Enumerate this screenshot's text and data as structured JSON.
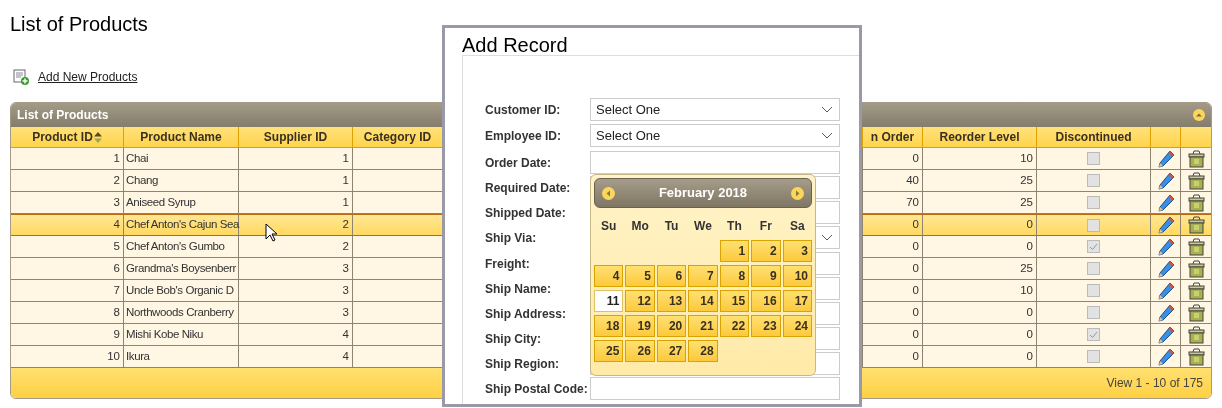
{
  "page_title": "List of Products",
  "add_link": "Add New Products",
  "grid": {
    "title": "List of Products",
    "columns": [
      {
        "label": "Product ID",
        "sorted": true
      },
      {
        "label": "Product Name",
        "sorted": false
      },
      {
        "label": "Supplier ID",
        "sorted": false
      },
      {
        "label": "Category ID",
        "sorted": false
      },
      {
        "label": "n Order",
        "sorted": false
      },
      {
        "label": "Reorder Level",
        "sorted": false
      },
      {
        "label": "Discontinued",
        "sorted": false
      }
    ],
    "rows": [
      {
        "product_id": "1",
        "product_name": "Chai",
        "supplier_id": "1",
        "on_order": "0",
        "reorder_level": "10",
        "discontinued": false,
        "selected": false
      },
      {
        "product_id": "2",
        "product_name": "Chang",
        "supplier_id": "1",
        "on_order": "40",
        "reorder_level": "25",
        "discontinued": false,
        "selected": false
      },
      {
        "product_id": "3",
        "product_name": "Aniseed Syrup",
        "supplier_id": "1",
        "on_order": "70",
        "reorder_level": "25",
        "discontinued": false,
        "selected": false
      },
      {
        "product_id": "4",
        "product_name": "Chef Anton's Cajun Sea",
        "supplier_id": "2",
        "on_order": "0",
        "reorder_level": "0",
        "discontinued": false,
        "selected": true
      },
      {
        "product_id": "5",
        "product_name": "Chef Anton's Gumbo",
        "supplier_id": "2",
        "on_order": "0",
        "reorder_level": "0",
        "discontinued": true,
        "selected": false
      },
      {
        "product_id": "6",
        "product_name": "Grandma's Boysenberr",
        "supplier_id": "3",
        "on_order": "0",
        "reorder_level": "25",
        "discontinued": false,
        "selected": false
      },
      {
        "product_id": "7",
        "product_name": "Uncle Bob's Organic D",
        "supplier_id": "3",
        "on_order": "0",
        "reorder_level": "10",
        "discontinued": false,
        "selected": false
      },
      {
        "product_id": "8",
        "product_name": "Northwoods Cranberry",
        "supplier_id": "3",
        "on_order": "0",
        "reorder_level": "0",
        "discontinued": false,
        "selected": false
      },
      {
        "product_id": "9",
        "product_name": "Mishi Kobe Niku",
        "supplier_id": "4",
        "on_order": "0",
        "reorder_level": "0",
        "discontinued": true,
        "selected": false
      },
      {
        "product_id": "10",
        "product_name": "Ikura",
        "supplier_id": "4",
        "on_order": "0",
        "reorder_level": "0",
        "discontinued": false,
        "selected": false
      }
    ],
    "footer": "View 1 - 10 of 175"
  },
  "dialog": {
    "title": "Add Record",
    "fields": [
      {
        "label": "Customer ID:",
        "kind": "select",
        "value": "Select One"
      },
      {
        "label": "Employee ID:",
        "kind": "select",
        "value": "Select One"
      },
      {
        "label": "Order Date:",
        "kind": "text"
      },
      {
        "label": "Required Date:",
        "kind": "text"
      },
      {
        "label": "Shipped Date:",
        "kind": "text"
      },
      {
        "label": "Ship Via:",
        "kind": "select"
      },
      {
        "label": "Freight:",
        "kind": "text"
      },
      {
        "label": "Ship Name:",
        "kind": "text"
      },
      {
        "label": "Ship Address:",
        "kind": "text"
      },
      {
        "label": "Ship City:",
        "kind": "text"
      },
      {
        "label": "Ship Region:",
        "kind": "text"
      },
      {
        "label": "Ship Postal Code:",
        "kind": "text"
      }
    ],
    "calendar": {
      "month": "February 2018",
      "weekdays": [
        "Su",
        "Mo",
        "Tu",
        "We",
        "Th",
        "Fr",
        "Sa"
      ],
      "weeks": [
        [
          {
            "kind": "blank"
          },
          {
            "kind": "blank"
          },
          {
            "kind": "blank"
          },
          {
            "kind": "blank"
          },
          {
            "day": "1",
            "today": false
          },
          {
            "day": "2",
            "today": false
          },
          {
            "day": "3",
            "today": false
          }
        ],
        [
          {
            "day": "4",
            "today": false
          },
          {
            "day": "5",
            "today": false
          },
          {
            "day": "6",
            "today": false
          },
          {
            "day": "7",
            "today": false
          },
          {
            "day": "8",
            "today": false
          },
          {
            "day": "9",
            "today": false
          },
          {
            "day": "10",
            "today": false
          }
        ],
        [
          {
            "day": "11",
            "today": true
          },
          {
            "day": "12",
            "today": false
          },
          {
            "day": "13",
            "today": false
          },
          {
            "day": "14",
            "today": false
          },
          {
            "day": "15",
            "today": false
          },
          {
            "day": "16",
            "today": false
          },
          {
            "day": "17",
            "today": false
          }
        ],
        [
          {
            "day": "18",
            "today": false
          },
          {
            "day": "19",
            "today": false
          },
          {
            "day": "20",
            "today": false
          },
          {
            "day": "21",
            "today": false
          },
          {
            "day": "22",
            "today": false
          },
          {
            "day": "23",
            "today": false
          },
          {
            "day": "24",
            "today": false
          }
        ],
        [
          {
            "day": "25",
            "today": false
          },
          {
            "day": "26",
            "today": false
          },
          {
            "day": "27",
            "today": false
          },
          {
            "day": "28",
            "today": false
          },
          {
            "kind": "blank"
          },
          {
            "kind": "blank"
          },
          {
            "kind": "blank"
          }
        ]
      ]
    }
  }
}
